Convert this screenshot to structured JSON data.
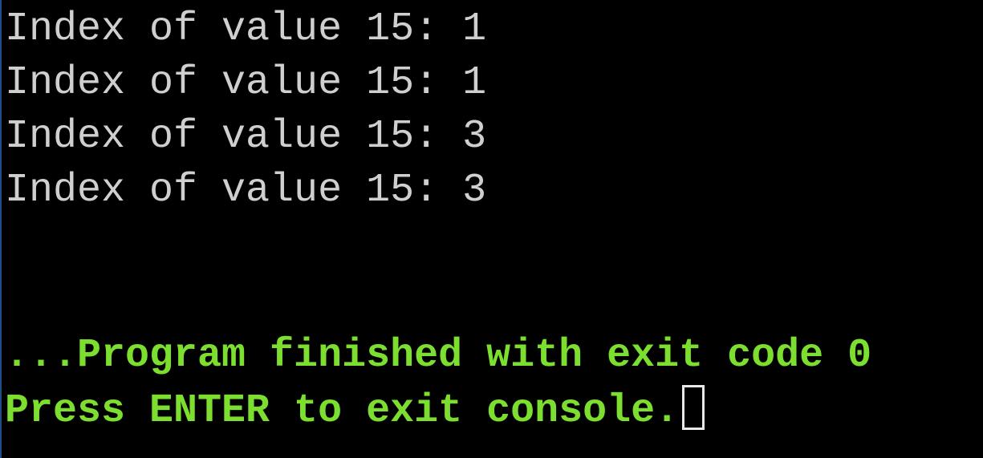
{
  "console": {
    "output_lines": [
      "Index of value 15: 1",
      "Index of value 15: 1",
      "Index of value 15: 3",
      "Index of value 15: 3"
    ],
    "status_lines": [
      "...Program finished with exit code 0",
      "Press ENTER to exit console."
    ]
  },
  "colors": {
    "background": "#000000",
    "output_text": "#cfcfcf",
    "status_text": "#7cde2e",
    "cursor": "#e8e8e8"
  }
}
